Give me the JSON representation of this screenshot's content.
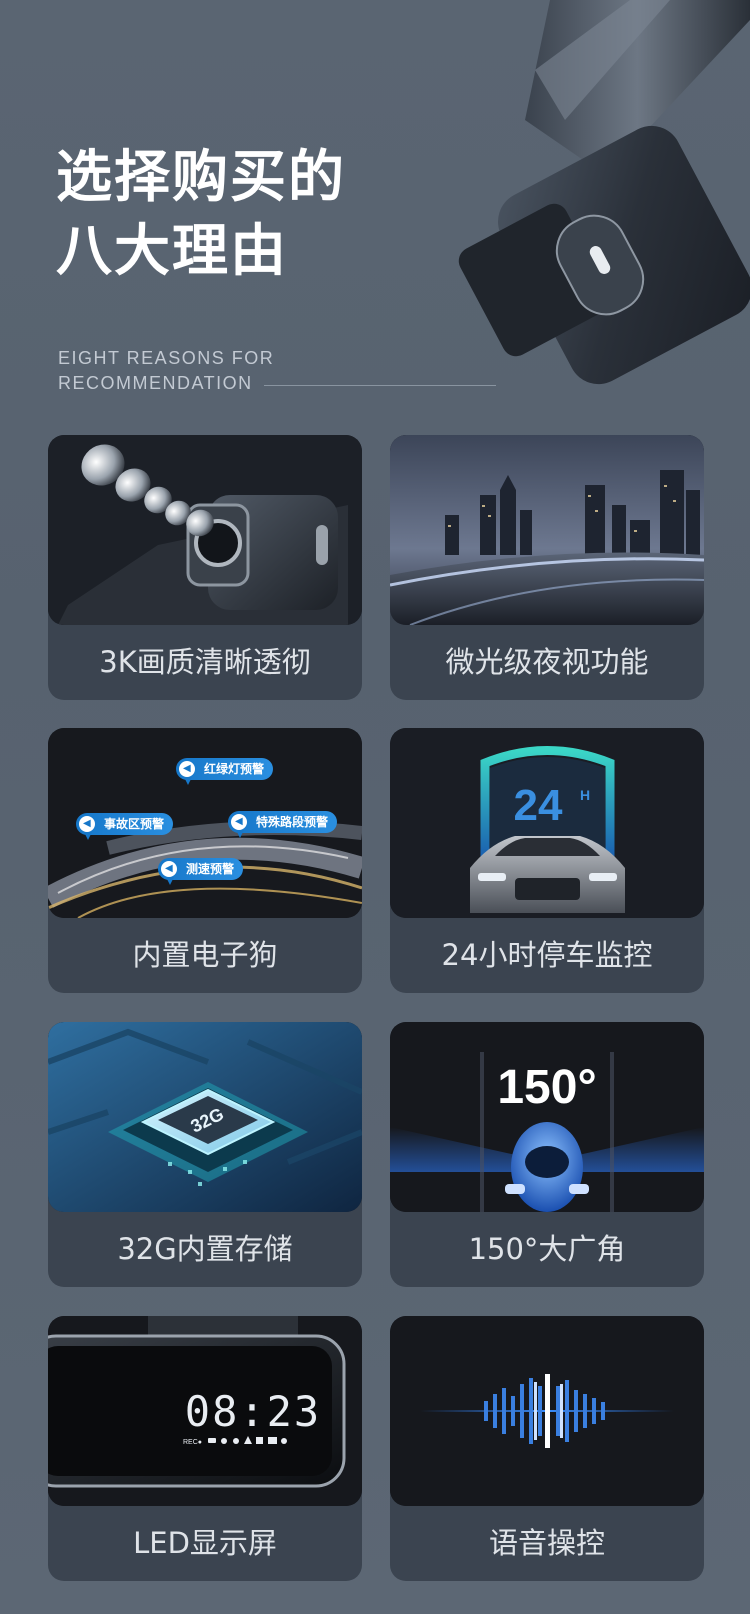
{
  "header": {
    "title_line1": "选择购买的",
    "title_line2": "八大理由",
    "subtitle_line1": "EIGHT REASONS FOR",
    "subtitle_line2": "RECOMMENDATION"
  },
  "features": [
    {
      "label": "3K画质清晰透彻"
    },
    {
      "label": "微光级夜视功能"
    },
    {
      "label": "内置电子狗"
    },
    {
      "label": "24小时停车监控"
    },
    {
      "label": "32G内置存储"
    },
    {
      "label": "150°大广角"
    },
    {
      "label": "LED显示屏"
    },
    {
      "label": "语音操控"
    }
  ],
  "dog_tags": [
    "红绿灯预警",
    "事故区预警",
    "特殊路段预警",
    "测速预警"
  ],
  "parking_badge": "24",
  "parking_badge_sup": "H",
  "storage_chip": "32G",
  "wide_angle": "150°",
  "led_time": "08:23",
  "led_status": "REC●",
  "colors": {
    "accent_blue": "#1677c9",
    "card_bg": "#3b4450",
    "page_bg": "#5a6572"
  }
}
